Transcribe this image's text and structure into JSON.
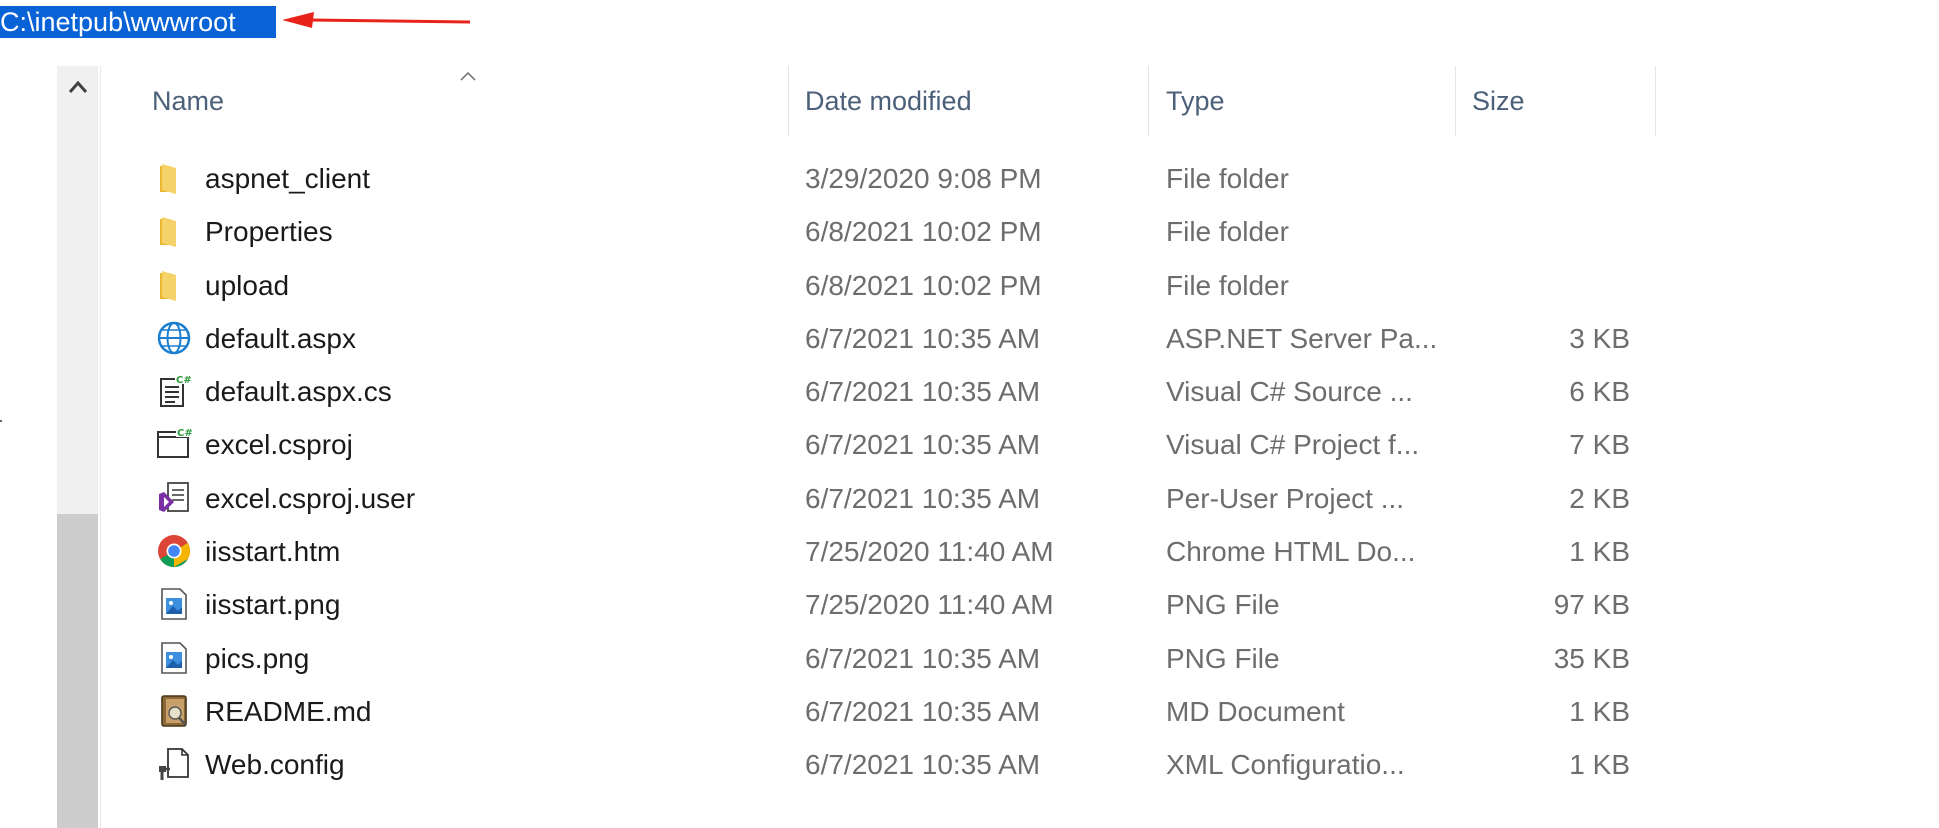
{
  "address": {
    "path": "C:\\inetpub\\wwwroot"
  },
  "columns": {
    "name": "Name",
    "date": "Date modified",
    "type": "Type",
    "size": "Size"
  },
  "files": [
    {
      "icon": "folder-icon",
      "name": "aspnet_client",
      "date": "3/29/2020 9:08 PM",
      "type": "File folder",
      "size": ""
    },
    {
      "icon": "folder-icon",
      "name": "Properties",
      "date": "6/8/2021 10:02 PM",
      "type": "File folder",
      "size": ""
    },
    {
      "icon": "folder-icon",
      "name": "upload",
      "date": "6/8/2021 10:02 PM",
      "type": "File folder",
      "size": ""
    },
    {
      "icon": "globe-icon",
      "name": "default.aspx",
      "date": "6/7/2021 10:35 AM",
      "type": "ASP.NET Server Pa...",
      "size": "3 KB"
    },
    {
      "icon": "csharp-source-icon",
      "name": "default.aspx.cs",
      "date": "6/7/2021 10:35 AM",
      "type": "Visual C# Source ...",
      "size": "6 KB"
    },
    {
      "icon": "csharp-project-icon",
      "name": "excel.csproj",
      "date": "6/7/2021 10:35 AM",
      "type": "Visual C# Project f...",
      "size": "7 KB"
    },
    {
      "icon": "visual-studio-user-icon",
      "name": "excel.csproj.user",
      "date": "6/7/2021 10:35 AM",
      "type": "Per-User Project ...",
      "size": "2 KB"
    },
    {
      "icon": "chrome-icon",
      "name": "iisstart.htm",
      "date": "7/25/2020 11:40 AM",
      "type": "Chrome HTML Do...",
      "size": "1 KB"
    },
    {
      "icon": "png-image-icon",
      "name": "iisstart.png",
      "date": "7/25/2020 11:40 AM",
      "type": "PNG File",
      "size": "97 KB"
    },
    {
      "icon": "png-image-icon",
      "name": "pics.png",
      "date": "6/7/2021 10:35 AM",
      "type": "PNG File",
      "size": "35 KB"
    },
    {
      "icon": "markdown-document-icon",
      "name": "README.md",
      "date": "6/7/2021 10:35 AM",
      "type": "MD Document",
      "size": "1 KB"
    },
    {
      "icon": "config-file-icon",
      "name": "Web.config",
      "date": "6/7/2021 10:35 AM",
      "type": "XML Configuratio...",
      "size": "1 KB"
    }
  ],
  "colors": {
    "selection": "#0a63d6",
    "arrow": "#e8231a",
    "header_text": "#4c607a",
    "folder": "#f5c542"
  }
}
